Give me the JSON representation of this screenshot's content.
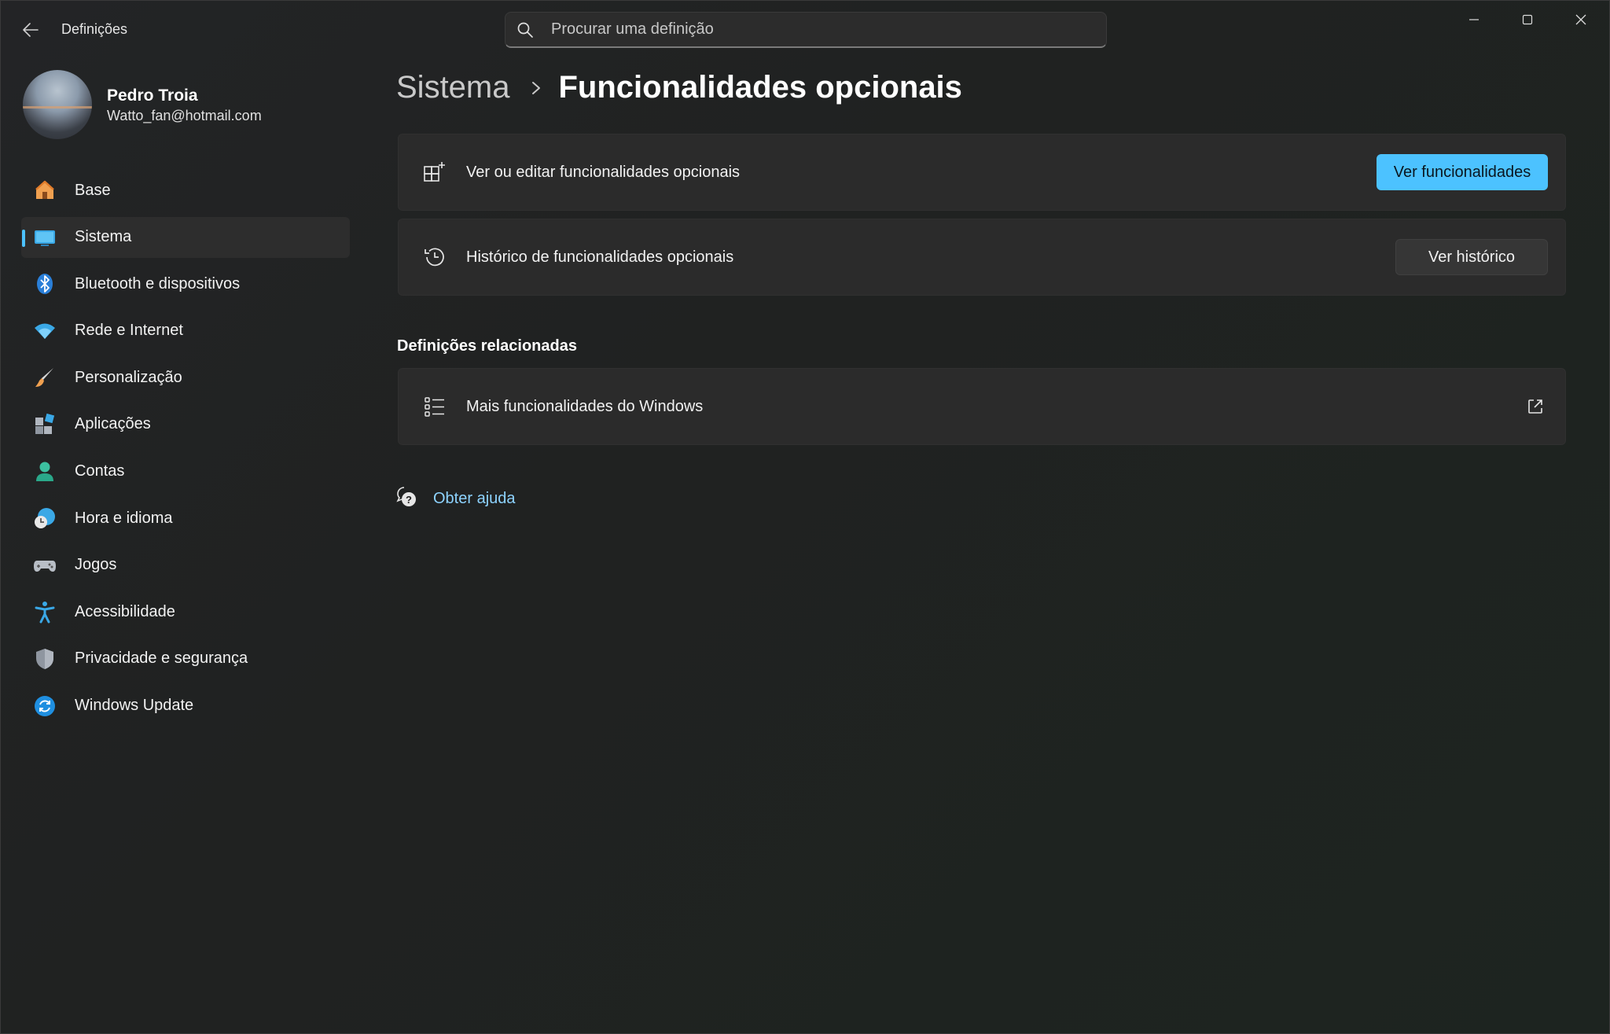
{
  "window": {
    "title": "Definições",
    "controls": {
      "minimize": "minimize-icon",
      "maximize": "maximize-icon",
      "close": "close-icon"
    }
  },
  "search": {
    "placeholder": "Procurar uma definição",
    "value": ""
  },
  "profile": {
    "name": "Pedro Troia",
    "email": "Watto_fan@hotmail.com"
  },
  "sidebar": {
    "items": [
      {
        "label": "Base",
        "icon": "home-icon",
        "active": false
      },
      {
        "label": "Sistema",
        "icon": "system-display-icon",
        "active": true
      },
      {
        "label": "Bluetooth e dispositivos",
        "icon": "bluetooth-icon",
        "active": false
      },
      {
        "label": "Rede e Internet",
        "icon": "wifi-icon",
        "active": false
      },
      {
        "label": "Personalização",
        "icon": "brush-icon",
        "active": false
      },
      {
        "label": "Aplicações",
        "icon": "apps-icon",
        "active": false
      },
      {
        "label": "Contas",
        "icon": "account-icon",
        "active": false
      },
      {
        "label": "Hora e idioma",
        "icon": "time-language-icon",
        "active": false
      },
      {
        "label": "Jogos",
        "icon": "gamepad-icon",
        "active": false
      },
      {
        "label": "Acessibilidade",
        "icon": "accessibility-icon",
        "active": false
      },
      {
        "label": "Privacidade e segurança",
        "icon": "shield-icon",
        "active": false
      },
      {
        "label": "Windows Update",
        "icon": "update-icon",
        "active": false
      }
    ]
  },
  "breadcrumb": {
    "parent": "Sistema",
    "current": "Funcionalidades opcionais"
  },
  "cards": {
    "optional": {
      "label": "Ver ou editar funcionalidades opcionais",
      "button": "Ver funcionalidades",
      "icon": "add-feature-icon"
    },
    "history": {
      "label": "Histórico de funcionalidades opcionais",
      "button": "Ver histórico",
      "icon": "history-icon"
    }
  },
  "related": {
    "title": "Definições relacionadas",
    "items": [
      {
        "label": "Mais funcionalidades do Windows",
        "icon": "list-icon",
        "trailing_icon": "external-link-icon"
      }
    ]
  },
  "help": {
    "label": "Obter ajuda",
    "icon": "help-chat-icon"
  },
  "colors": {
    "accent": "#4cc2ff",
    "link": "#8dd3ff",
    "card": "#2b2b2b",
    "background": "#202221"
  }
}
